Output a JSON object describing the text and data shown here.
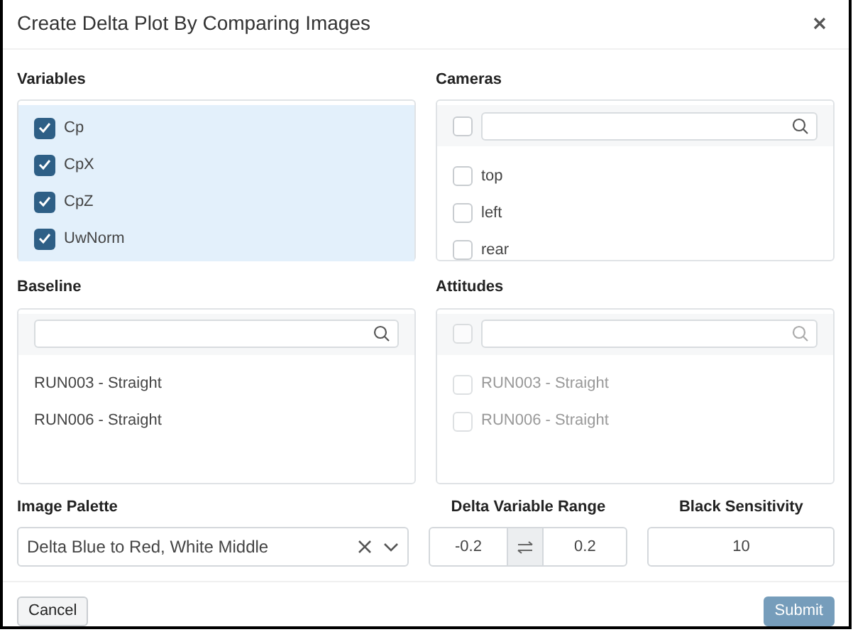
{
  "dialog": {
    "title": "Create Delta Plot By Comparing Images"
  },
  "panels": [
    {
      "label": "Variables",
      "kind": "checklist",
      "disabled": false,
      "items": [
        {
          "label": "Cp",
          "checked": true
        },
        {
          "label": "CpX",
          "checked": true
        },
        {
          "label": "CpZ",
          "checked": true
        },
        {
          "label": "UwNorm",
          "checked": true
        }
      ]
    },
    {
      "label": "Cameras",
      "kind": "search-checklist",
      "disabled": false,
      "select_all": {
        "checked": false
      },
      "items": [
        {
          "label": "top",
          "checked": false
        },
        {
          "label": "left",
          "checked": false
        },
        {
          "label": "rear",
          "checked": false
        }
      ]
    },
    {
      "label": "Baseline",
      "kind": "search-list",
      "disabled": false,
      "items": [
        {
          "label": "RUN003 - Straight"
        },
        {
          "label": "RUN006 - Straight"
        }
      ]
    },
    {
      "label": "Attitudes",
      "kind": "search-checklist",
      "disabled": true,
      "select_all": {
        "checked": false
      },
      "items": [
        {
          "label": "RUN003 - Straight",
          "checked": false
        },
        {
          "label": "RUN006 - Straight",
          "checked": false
        }
      ]
    }
  ],
  "palette": {
    "label": "Image Palette",
    "value": "Delta Blue to Red, White Middle"
  },
  "range": {
    "label": "Delta Variable Range",
    "min": "-0.2",
    "max": "0.2"
  },
  "sensitivity": {
    "label": "Black Sensitivity",
    "value": "10"
  },
  "buttons": [
    {
      "label": "Cancel",
      "kind": "secondary",
      "disabled": false
    },
    {
      "label": "Submit",
      "kind": "primary",
      "disabled": true
    }
  ]
}
